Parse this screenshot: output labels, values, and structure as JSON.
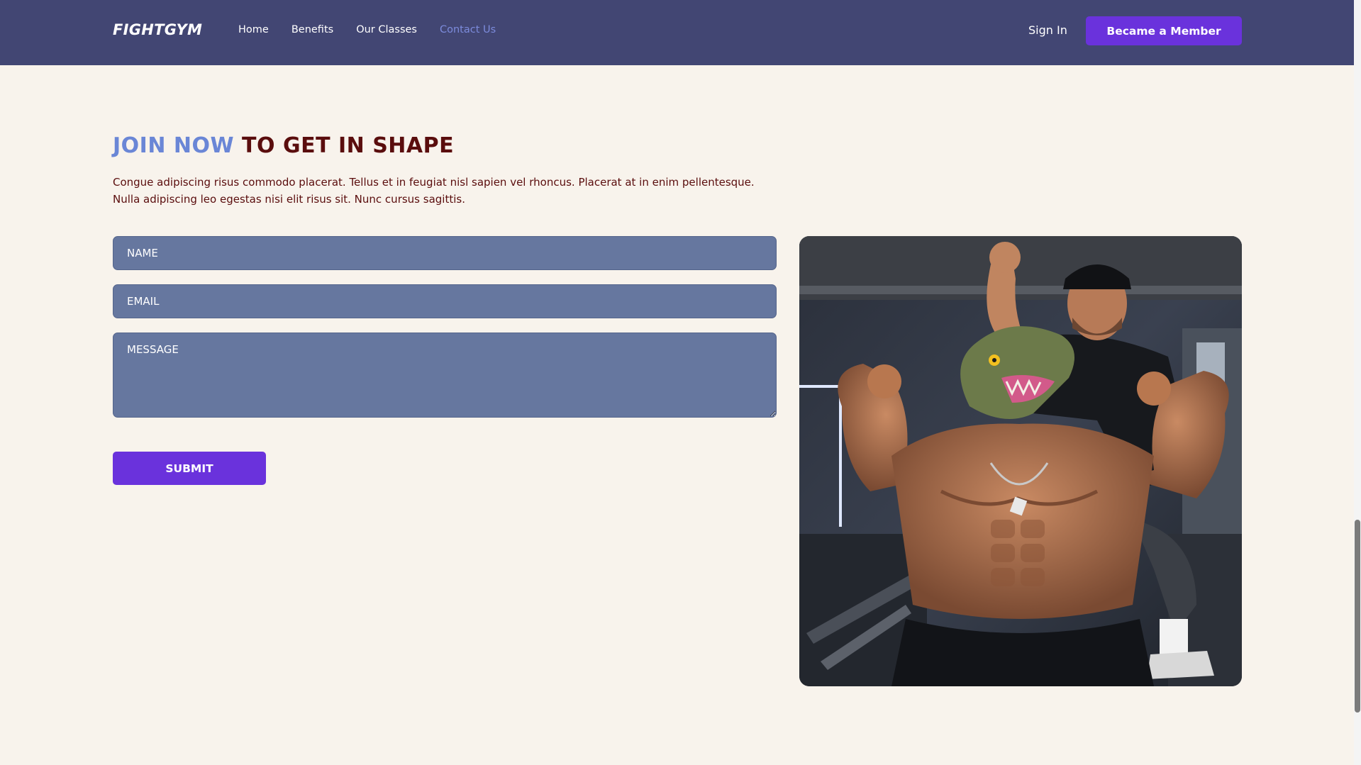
{
  "nav": {
    "logo": "FIGHTGYM",
    "links": [
      "Home",
      "Benefits",
      "Our Classes",
      "Contact Us"
    ],
    "active_link": "Contact Us",
    "sign_in": "Sign In",
    "cta": "Became a Member"
  },
  "contact": {
    "heading_highlight": "JOIN NOW",
    "heading_rest": " TO GET IN SHAPE",
    "description": "Congue adipiscing risus commodo placerat. Tellus et in feugiat nisl sapien vel rhoncus. Placerat at in enim pellentesque. Nulla adipiscing leo egestas nisi elit risus sit. Nunc cursus sagittis.",
    "name_placeholder": "NAME",
    "email_placeholder": "EMAIL",
    "message_placeholder": "MESSAGE",
    "submit_label": "SUBMIT"
  },
  "colors": {
    "nav_bg": "#424673",
    "page_bg": "#f8f3ec",
    "accent_purple": "#6a32dc",
    "highlight_blue": "#6a86d6",
    "heading_dark": "#5a0d0d",
    "input_bg": "#66779f"
  }
}
